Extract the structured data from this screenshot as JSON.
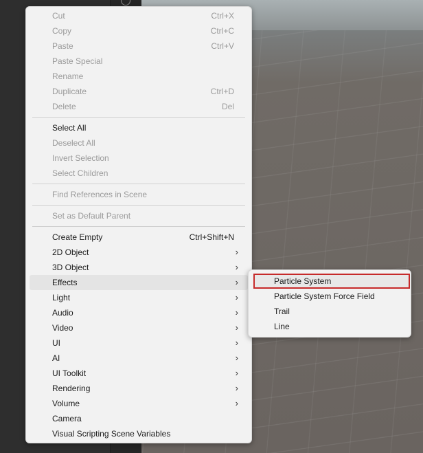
{
  "main_menu": {
    "items": [
      {
        "label": "Cut",
        "shortcut": "Ctrl+X",
        "disabled": true
      },
      {
        "label": "Copy",
        "shortcut": "Ctrl+C",
        "disabled": true
      },
      {
        "label": "Paste",
        "shortcut": "Ctrl+V",
        "disabled": true
      },
      {
        "label": "Paste Special",
        "disabled": true
      },
      {
        "label": "Rename",
        "disabled": true
      },
      {
        "label": "Duplicate",
        "shortcut": "Ctrl+D",
        "disabled": true
      },
      {
        "label": "Delete",
        "shortcut": "Del",
        "disabled": true
      },
      {
        "label": "Select All",
        "disabled": false
      },
      {
        "label": "Deselect All",
        "disabled": true
      },
      {
        "label": "Invert Selection",
        "disabled": true
      },
      {
        "label": "Select Children",
        "disabled": true
      },
      {
        "label": "Find References in Scene",
        "disabled": true
      },
      {
        "label": "Set as Default Parent",
        "disabled": true
      },
      {
        "label": "Create Empty",
        "shortcut": "Ctrl+Shift+N",
        "disabled": false
      },
      {
        "label": "2D Object",
        "submenu": true
      },
      {
        "label": "3D Object",
        "submenu": true
      },
      {
        "label": "Effects",
        "submenu": true,
        "active": true
      },
      {
        "label": "Light",
        "submenu": true
      },
      {
        "label": "Audio",
        "submenu": true
      },
      {
        "label": "Video",
        "submenu": true
      },
      {
        "label": "UI",
        "submenu": true
      },
      {
        "label": "AI",
        "submenu": true
      },
      {
        "label": "UI Toolkit",
        "submenu": true
      },
      {
        "label": "Rendering",
        "submenu": true
      },
      {
        "label": "Volume",
        "submenu": true
      },
      {
        "label": "Camera",
        "disabled": false
      },
      {
        "label": "Visual Scripting Scene Variables",
        "disabled": false
      }
    ],
    "submenu_arrow": "›"
  },
  "effects_submenu": {
    "items": [
      {
        "label": "Particle System",
        "highlighted": true
      },
      {
        "label": "Particle System Force Field"
      },
      {
        "label": "Trail"
      },
      {
        "label": "Line"
      }
    ]
  },
  "colors": {
    "highlight_border": "#c62a2a",
    "menu_bg": "#f2f2f2"
  }
}
